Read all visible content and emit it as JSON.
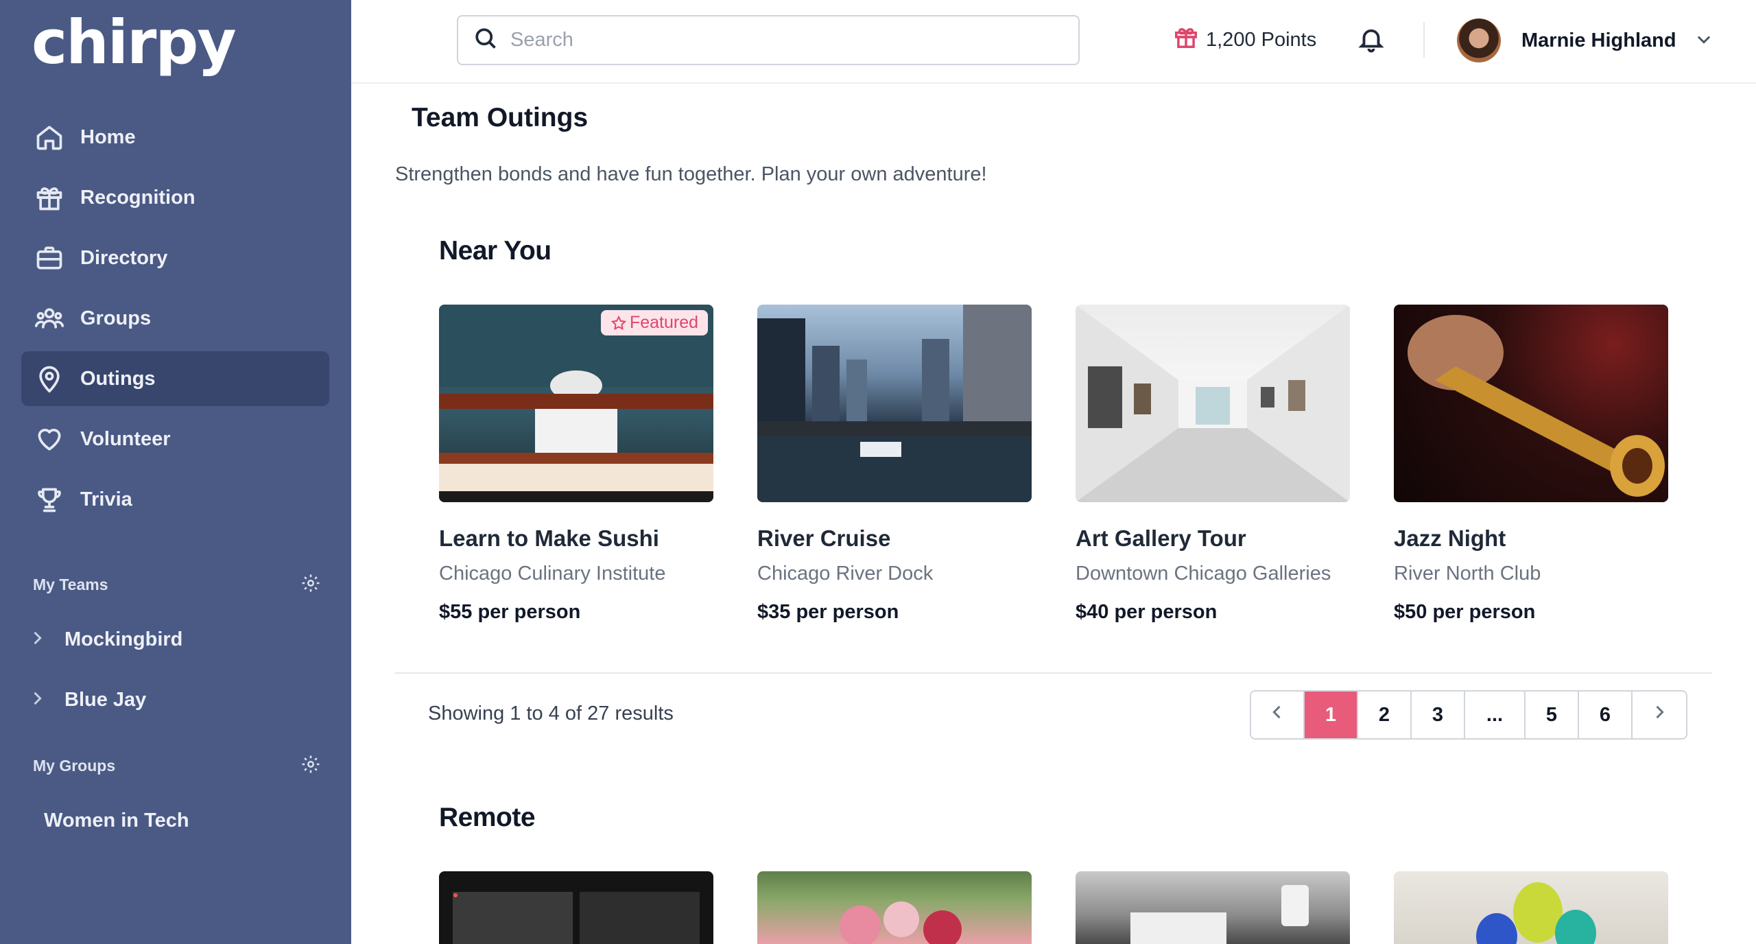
{
  "app": {
    "logo": "chirpy"
  },
  "sidebar": {
    "nav": [
      {
        "label": "Home",
        "icon": "home-icon"
      },
      {
        "label": "Recognition",
        "icon": "gift-icon"
      },
      {
        "label": "Directory",
        "icon": "briefcase-icon"
      },
      {
        "label": "Groups",
        "icon": "users-icon"
      },
      {
        "label": "Outings",
        "icon": "map-pin-icon",
        "active": true
      },
      {
        "label": "Volunteer",
        "icon": "heart-icon"
      },
      {
        "label": "Trivia",
        "icon": "trophy-icon"
      }
    ],
    "my_teams": {
      "title": "My Teams",
      "items": [
        "Mockingbird",
        "Blue Jay"
      ]
    },
    "my_groups": {
      "title": "My Groups",
      "items": [
        "Women in Tech"
      ]
    }
  },
  "header": {
    "search_placeholder": "Search",
    "points": "1,200 Points",
    "user_name": "Marnie Highland"
  },
  "page": {
    "title": "Team Outings",
    "subtitle": "Strengthen bonds and have fun together. Plan your own adventure!"
  },
  "near_you": {
    "title": "Near You",
    "cards": [
      {
        "title": "Learn to Make Sushi",
        "location": "Chicago Culinary Institute",
        "price": "$55 per person",
        "badge": "Featured"
      },
      {
        "title": "River Cruise",
        "location": "Chicago River Dock",
        "price": "$35 per person"
      },
      {
        "title": "Art Gallery Tour",
        "location": "Downtown Chicago Galleries",
        "price": "$40 per person"
      },
      {
        "title": "Jazz Night",
        "location": "River North Club",
        "price": "$50 per person"
      }
    ]
  },
  "pagination": {
    "results_text": "Showing 1 to 4 of 27 results",
    "pages": [
      "1",
      "2",
      "3",
      "...",
      "5",
      "6"
    ],
    "current": "1"
  },
  "remote": {
    "title": "Remote"
  },
  "colors": {
    "sidebar": "#4a5a85",
    "sidebar_active": "#38466d",
    "accent": "#e85b7a"
  }
}
